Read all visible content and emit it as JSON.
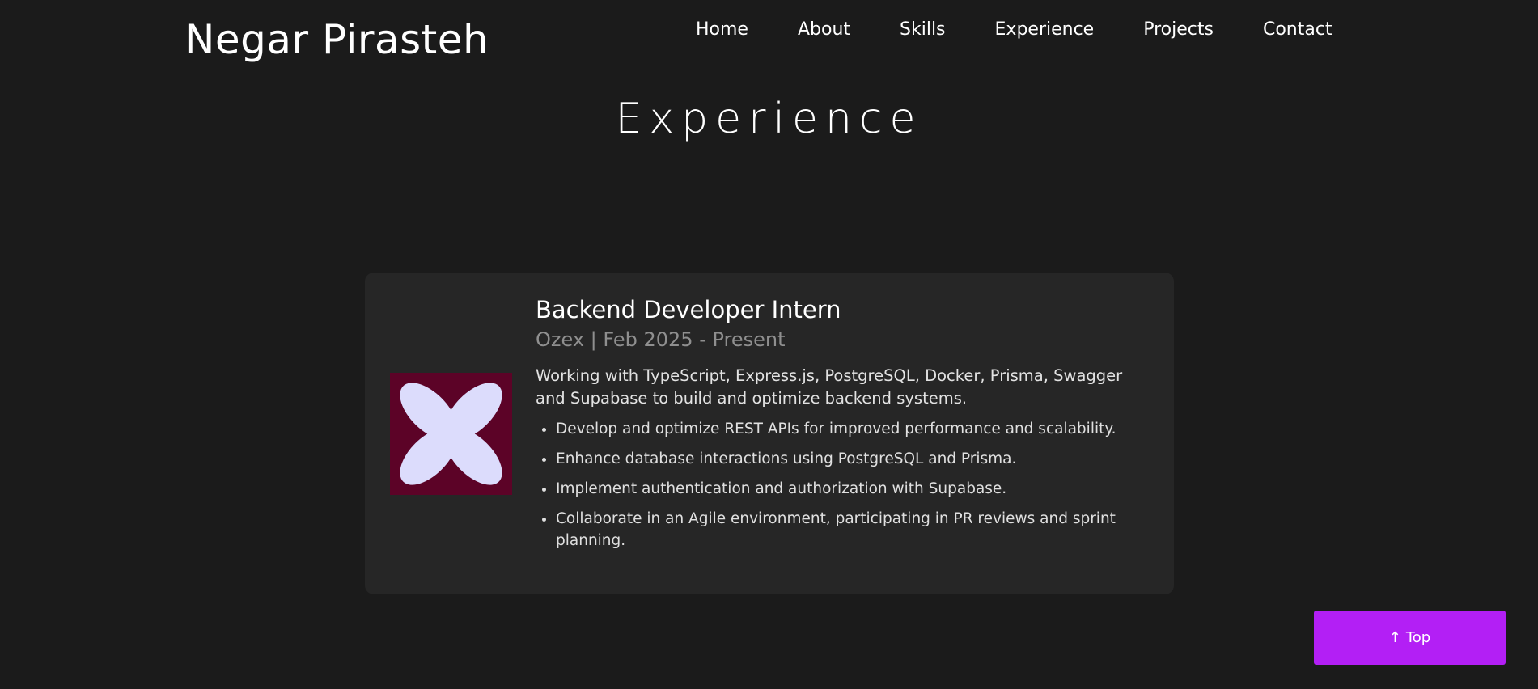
{
  "header": {
    "brand": "Negar Pirasteh",
    "nav": [
      {
        "label": "Home"
      },
      {
        "label": "About"
      },
      {
        "label": "Skills"
      },
      {
        "label": "Experience"
      },
      {
        "label": "Projects"
      },
      {
        "label": "Contact"
      }
    ]
  },
  "section": {
    "title": "Experience"
  },
  "experience": {
    "title": "Backend Developer Intern",
    "meta": "Ozex | Feb 2025 - Present",
    "summary": "Working with TypeScript, Express.js, PostgreSQL, Docker, Prisma, Swagger and Supabase to build and optimize backend systems.",
    "points": [
      "Develop and optimize REST APIs for improved performance and scalability.",
      "Enhance database interactions using PostgreSQL and Prisma.",
      "Implement authentication and authorization with Supabase.",
      "Collaborate in an Agile environment, participating in PR reviews and sprint planning."
    ],
    "logo_icon": "company-logo-petal-icon",
    "logo_colors": {
      "background": "#5c0327",
      "petals": "#dcdcfc"
    }
  },
  "top_button": {
    "arrow": "↑",
    "label": "Top"
  },
  "colors": {
    "background": "#1b1b1b",
    "card": "#262626",
    "accent": "#b31ff5"
  }
}
